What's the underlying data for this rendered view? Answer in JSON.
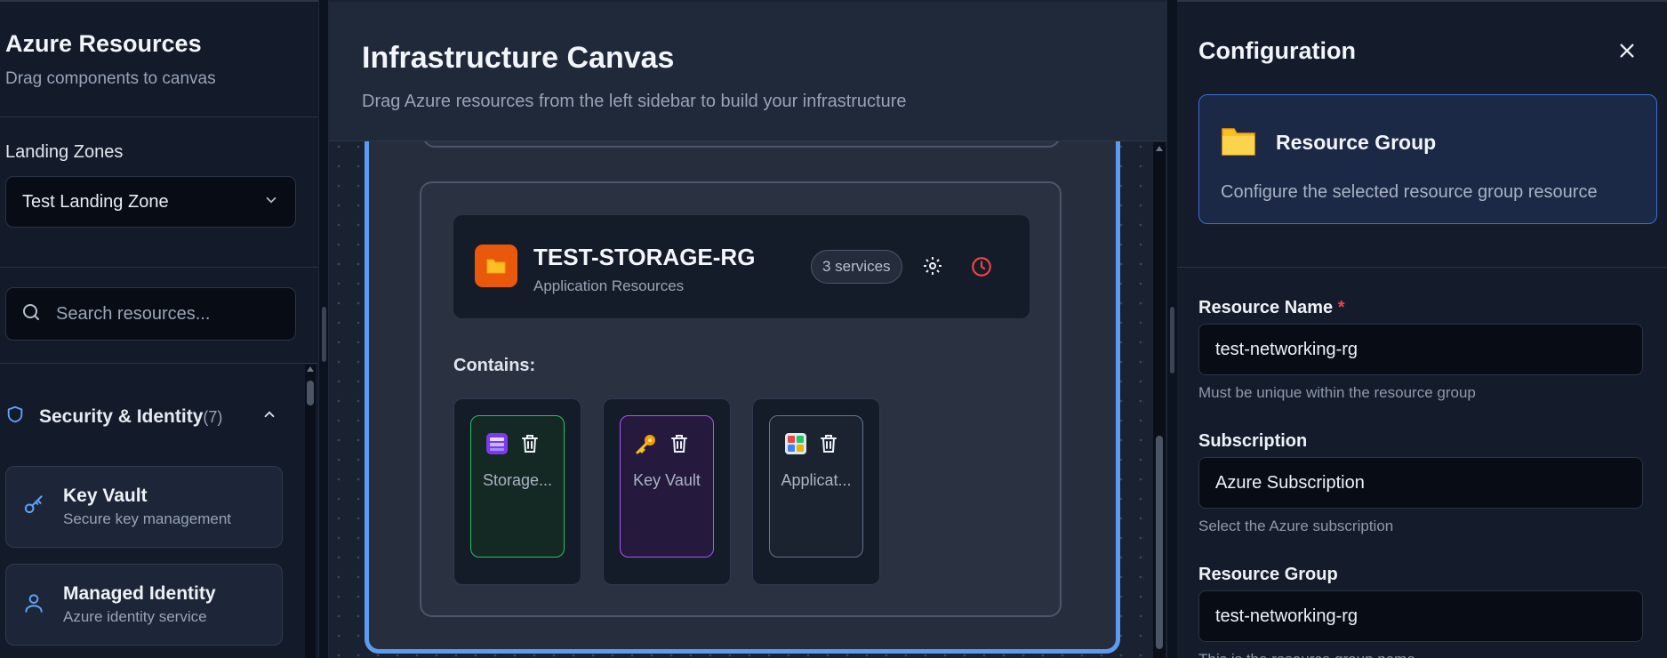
{
  "sidebar": {
    "title": "Azure Resources",
    "subtitle": "Drag components to canvas",
    "landing_zones_label": "Landing Zones",
    "landing_zone_selected": "Test Landing Zone",
    "search_placeholder": "Search resources...",
    "category": {
      "label": "Security & Identity",
      "count": "(7)"
    },
    "items": [
      {
        "name": "Key Vault",
        "desc": "Secure key management",
        "icon": "key-icon"
      },
      {
        "name": "Managed Identity",
        "desc": "Azure identity service",
        "icon": "user-icon"
      }
    ]
  },
  "canvas": {
    "title": "Infrastructure Canvas",
    "subtitle": "Drag Azure resources from the left sidebar to build your infrastructure",
    "resource_group": {
      "name": "TEST-STORAGE-RG",
      "type": "Application Resources",
      "services_badge": "3 services",
      "contains_label": "Contains:",
      "children": [
        {
          "label": "Storage...",
          "icon": "storage-icon",
          "accent": "#22c55e"
        },
        {
          "label": "Key Vault",
          "icon": "key-vault-icon",
          "accent": "#a855f7"
        },
        {
          "label": "Applicat...",
          "icon": "application-icon",
          "accent": "#64748b"
        }
      ]
    }
  },
  "config": {
    "title": "Configuration",
    "card_title": "Resource Group",
    "card_desc": "Configure the selected resource group resource",
    "fields": [
      {
        "label": "Resource Name",
        "required": "*",
        "value": "test-networking-rg",
        "help": "Must be unique within the resource group"
      },
      {
        "label": "Subscription",
        "value": "Azure Subscription",
        "help": "Select the Azure subscription"
      },
      {
        "label": "Resource Group",
        "value": "test-networking-rg",
        "help": "This is the resource group name"
      }
    ]
  },
  "colors": {
    "accent_blue": "#5b9cf0",
    "resource_group_orange": "#ea580c",
    "danger_red": "#ef4444"
  }
}
